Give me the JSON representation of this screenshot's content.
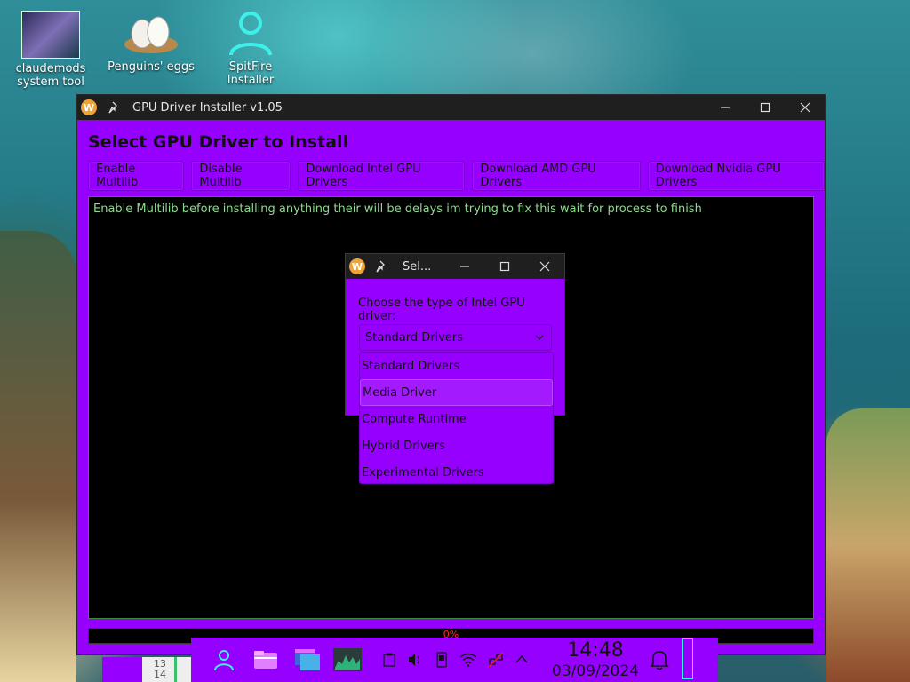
{
  "desktop": {
    "icons": [
      {
        "label_line1": "claudemods",
        "label_line2": "system tool"
      },
      {
        "label_line1": "Penguins' eggs",
        "label_line2": ""
      },
      {
        "label_line1": "SpitFire Installer",
        "label_line2": ""
      }
    ]
  },
  "main_window": {
    "app_logo": "W",
    "title": "GPU Driver Installer v1.05",
    "heading": "Select GPU Driver to Install",
    "buttons": [
      "Enable Multilib",
      "Disable Multilib",
      "Download Intel GPU Drivers",
      "Download AMD GPU Drivers",
      "Download Nvidia GPU Drivers"
    ],
    "console_text": "Enable Multilib before installing anything their will be delays im trying to fix this wait for process to finish",
    "progress_label": "0%",
    "progress_value": 0
  },
  "dialog": {
    "app_logo": "W",
    "title": "Sel...",
    "prompt": "Choose the type of Intel GPU driver:",
    "selected": "Standard Drivers",
    "options": [
      "Standard Drivers",
      "Media Driver",
      "Compute Runtime",
      "Hybrid Drivers",
      "Experimental Drivers"
    ],
    "hovered_index": 1
  },
  "taskbar": {
    "time": "14:48",
    "date": "03/09/2024",
    "calendar_numbers": [
      "13",
      "14"
    ]
  },
  "colors": {
    "accent": "#9600ff",
    "titlebar": "#1f1f1f",
    "console_bg": "#000000",
    "console_text": "#8fd88f",
    "progress_text": "#ff2a2a"
  }
}
